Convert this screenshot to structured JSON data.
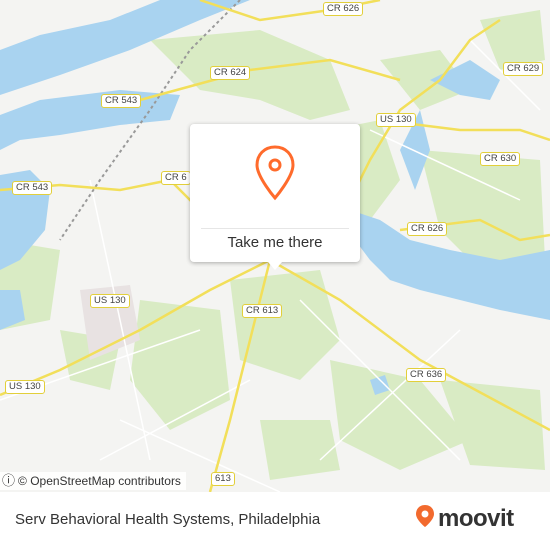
{
  "map": {
    "road_labels": [
      {
        "id": "cr626-top",
        "text": "CR 626"
      },
      {
        "id": "cr629",
        "text": "CR 629"
      },
      {
        "id": "cr624",
        "text": "CR 624"
      },
      {
        "id": "cr543-top",
        "text": "CR 543"
      },
      {
        "id": "us130-top",
        "text": "US 130"
      },
      {
        "id": "cr630",
        "text": "CR 630"
      },
      {
        "id": "cr543-left",
        "text": "CR 543"
      },
      {
        "id": "cr6-partial",
        "text": "CR 6"
      },
      {
        "id": "cr626-mid",
        "text": "CR 626"
      },
      {
        "id": "cr613",
        "text": "CR 613"
      },
      {
        "id": "us130-mid",
        "text": "US 130"
      },
      {
        "id": "us130-left",
        "text": "US 130"
      },
      {
        "id": "cr636",
        "text": "CR 636"
      },
      {
        "id": "cr613-bottom",
        "text": "613"
      }
    ],
    "colors": {
      "water": "#a9d3f0",
      "park": "#d9ebc4",
      "road_major": "#f2df5a",
      "background": "#f4f4f2"
    }
  },
  "popup": {
    "button_label": "Take me there",
    "pin_color": "#ff6b2c"
  },
  "attribution": {
    "text": "© OpenStreetMap contributors"
  },
  "footer": {
    "place_name": "Serv Behavioral Health Systems, Philadelphia",
    "brand": "moovit",
    "brand_color": "#f26a2e"
  }
}
